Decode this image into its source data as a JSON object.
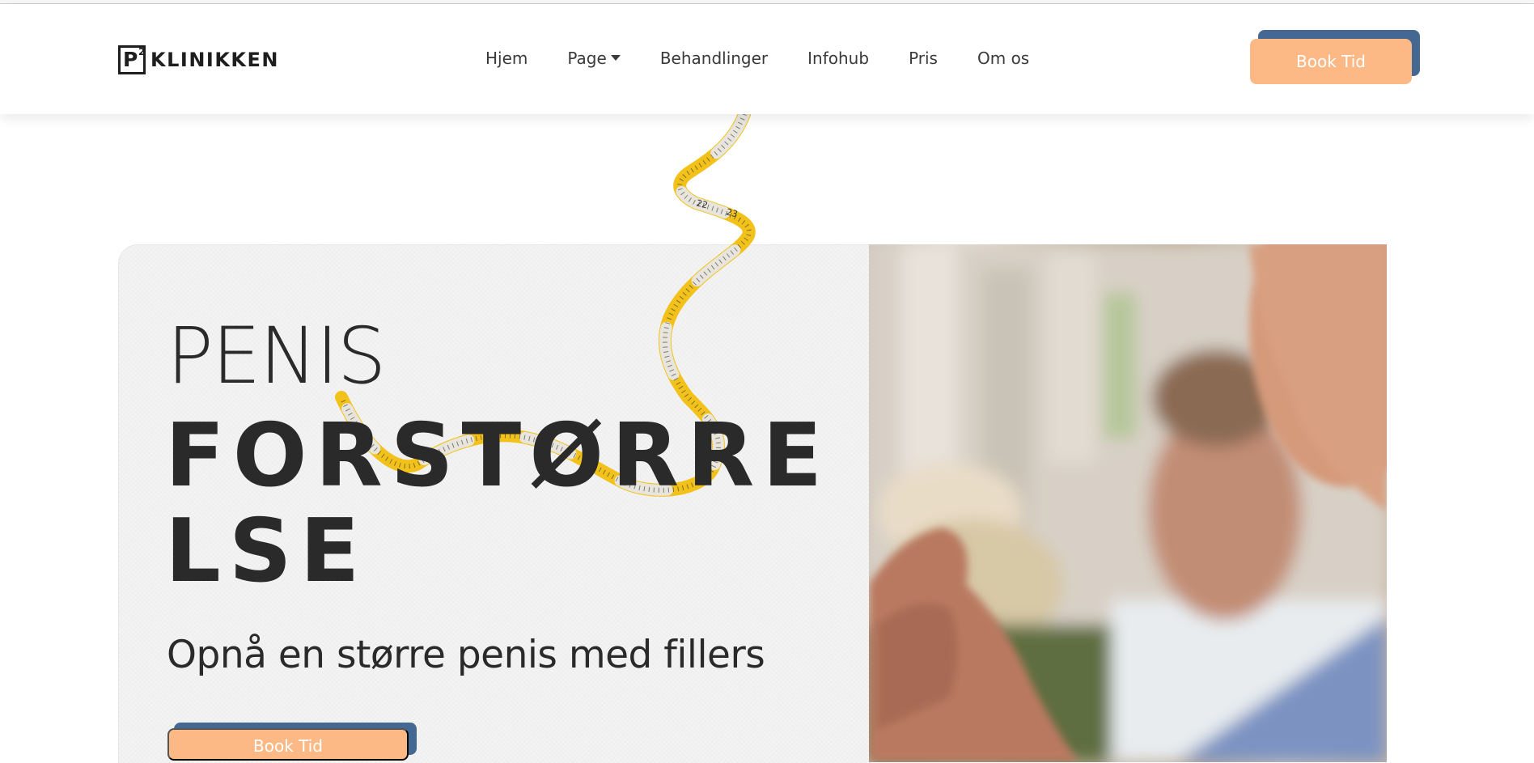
{
  "brand": {
    "logo_letter": "P",
    "logo_sup": "2",
    "name": "KLINIKKEN"
  },
  "nav": {
    "items": [
      {
        "label": "Hjem"
      },
      {
        "label": "Page"
      },
      {
        "label": "Behandlinger"
      },
      {
        "label": "Infohub"
      },
      {
        "label": "Pris"
      },
      {
        "label": "Om os"
      }
    ],
    "cta": "Book Tid"
  },
  "hero": {
    "title_light": "PENIS",
    "title_bold": "FORSTØRRELSE",
    "subtitle": "Opnå en større penis med fillers",
    "cta": "Book Tid"
  },
  "tape_numbers": [
    "22",
    "23"
  ],
  "colors": {
    "accent": "#fdb985",
    "accent_shadow": "#456892",
    "text": "#2a2a2a",
    "card_bg": "#f4f4f4"
  },
  "icons": {
    "dropdown": "caret-down-icon",
    "tape": "measuring-tape-icon"
  }
}
